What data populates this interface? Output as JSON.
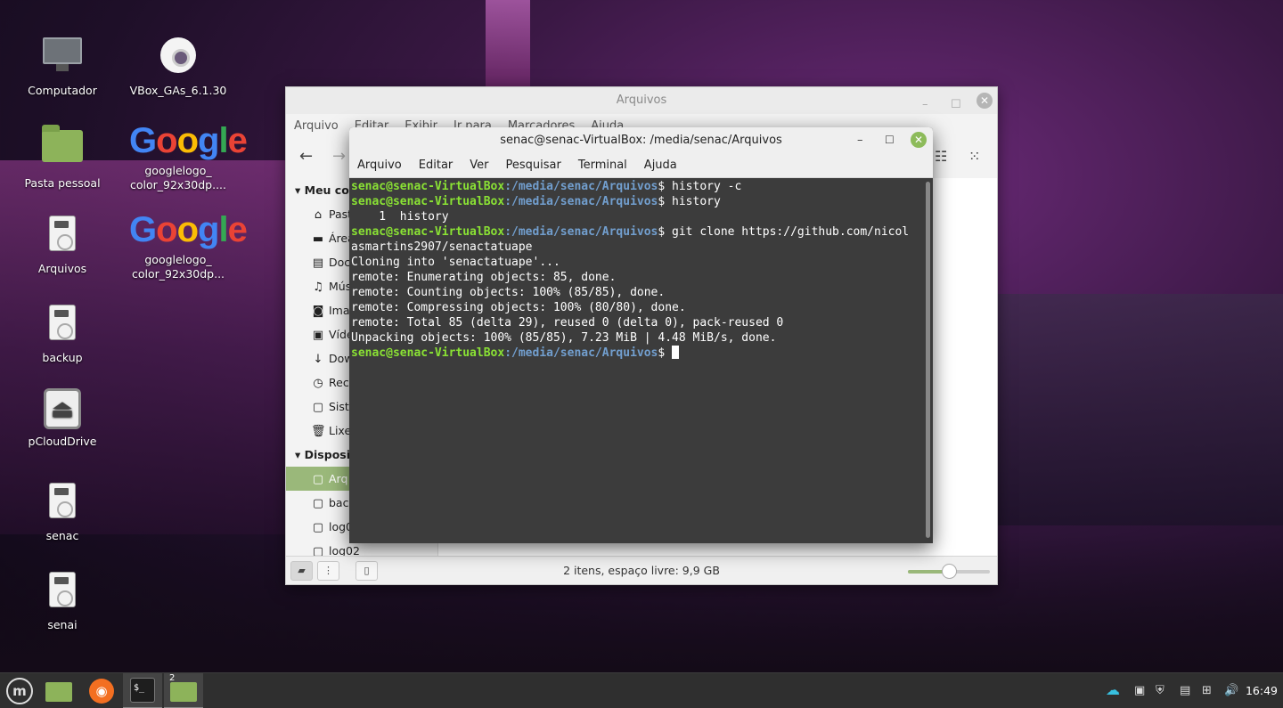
{
  "desktop": {
    "icons": [
      {
        "label": "Computador",
        "icon": "computer-icon"
      },
      {
        "label": "VBox_GAs_6.1.30",
        "icon": "optical-disc-icon"
      },
      {
        "label": "Pasta pessoal",
        "icon": "home-folder-icon"
      },
      {
        "label": "googlelogo_ color_92x30dp....",
        "icon": "google-logo-image"
      },
      {
        "label": "Arquivos",
        "icon": "drive-icon"
      },
      {
        "label": "googlelogo_ color_92x30dp...",
        "icon": "google-logo-image"
      },
      {
        "label": "backup",
        "icon": "drive-icon"
      },
      {
        "label": "pCloudDrive",
        "icon": "eject-drive-icon"
      },
      {
        "label": "senac",
        "icon": "drive-icon"
      },
      {
        "label": "senai",
        "icon": "drive-icon"
      }
    ],
    "google_letters": [
      "G",
      "o",
      "o",
      "g",
      "l",
      "e"
    ]
  },
  "file_manager": {
    "title": "Arquivos",
    "menu": [
      "Arquivo",
      "Editar",
      "Exibir",
      "Ir para",
      "Marcadores",
      "Ajuda"
    ],
    "sidebar": {
      "section_computer": "Meu co",
      "computer_items": [
        {
          "label": "Past",
          "icon": "home-icon"
        },
        {
          "label": "Área",
          "icon": "desktop-icon"
        },
        {
          "label": "Doc",
          "icon": "document-icon"
        },
        {
          "label": "Mús",
          "icon": "music-icon"
        },
        {
          "label": "Ima",
          "icon": "camera-icon"
        },
        {
          "label": "Víde",
          "icon": "film-icon"
        },
        {
          "label": "Dow",
          "icon": "download-icon"
        },
        {
          "label": "Rece",
          "icon": "recent-icon"
        },
        {
          "label": "Siste",
          "icon": "drive-icon"
        },
        {
          "label": "Lixe",
          "icon": "trash-icon"
        }
      ],
      "section_devices": "Disposi",
      "device_items": [
        {
          "label": "Arq",
          "icon": "drive-icon",
          "selected": true
        },
        {
          "label": "back",
          "icon": "drive-icon"
        },
        {
          "label": "log0",
          "icon": "drive-icon"
        },
        {
          "label": "log02",
          "icon": "drive-icon"
        }
      ]
    },
    "status": "2 itens, espaço livre: 9,9 GB",
    "zoom_level": 0.5
  },
  "terminal": {
    "title": "senac@senac-VirtualBox: /media/senac/Arquivos",
    "menu": [
      "Arquivo",
      "Editar",
      "Ver",
      "Pesquisar",
      "Terminal",
      "Ajuda"
    ],
    "prompt_user": "senac@senac-VirtualBox",
    "prompt_path": ":/media/senac/Arquivos",
    "prompt_sign": "$ ",
    "lines": [
      {
        "type": "prompt",
        "cmd": "history -c"
      },
      {
        "type": "prompt",
        "cmd": "history"
      },
      {
        "type": "out",
        "text": "    1  history"
      },
      {
        "type": "prompt",
        "cmd": "git clone https://github.com/nicol"
      },
      {
        "type": "out",
        "text": "asmartins2907/senactatuape"
      },
      {
        "type": "out",
        "text": "Cloning into 'senactatuape'..."
      },
      {
        "type": "out",
        "text": "remote: Enumerating objects: 85, done."
      },
      {
        "type": "out",
        "text": "remote: Counting objects: 100% (85/85), done."
      },
      {
        "type": "out",
        "text": "remote: Compressing objects: 100% (80/80), done."
      },
      {
        "type": "out",
        "text": "remote: Total 85 (delta 29), reused 0 (delta 0), pack-reused 0"
      },
      {
        "type": "out",
        "text": "Unpacking objects: 100% (85/85), 7.23 MiB | 4.48 MiB/s, done."
      },
      {
        "type": "prompt",
        "cmd": "",
        "cursor": true
      }
    ]
  },
  "taskbar": {
    "workspace_badge": "2",
    "clock": "16:49",
    "tray": [
      "cloud-sync-icon",
      "clipboard-icon",
      "shield-update-icon",
      "notes-icon",
      "network-icon",
      "volume-icon"
    ]
  },
  "colors": {
    "prompt_user": "#8ae234",
    "prompt_path": "#729fcf",
    "accent": "#9ab87a",
    "terminal_bg": "#3c3c3c"
  }
}
